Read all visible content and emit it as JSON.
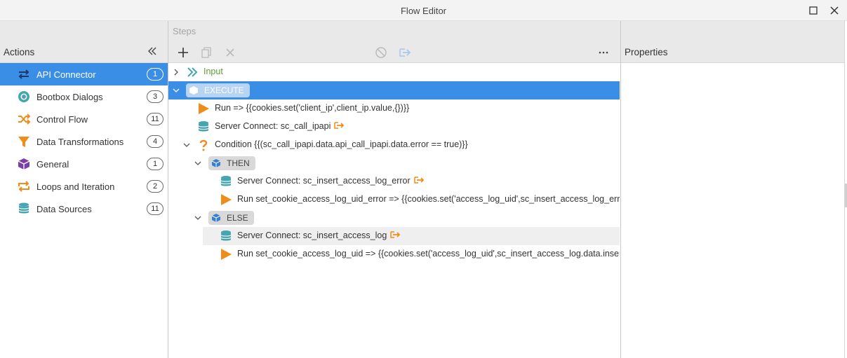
{
  "window": {
    "title": "Flow Editor"
  },
  "actions_panel": {
    "header": "Actions",
    "items": [
      {
        "label": "API Connector",
        "count": "1",
        "icon": "api-connector-icon",
        "selected": true
      },
      {
        "label": "Bootbox Dialogs",
        "count": "3",
        "icon": "chrome-icon"
      },
      {
        "label": "Control Flow",
        "count": "11",
        "icon": "shuffle-icon"
      },
      {
        "label": "Data Transformations",
        "count": "4",
        "icon": "funnel-icon"
      },
      {
        "label": "General",
        "count": "1",
        "icon": "cube-icon"
      },
      {
        "label": "Loops and Iteration",
        "count": "2",
        "icon": "loop-icon"
      },
      {
        "label": "Data Sources",
        "count": "11",
        "icon": "database-icon"
      }
    ]
  },
  "steps_panel": {
    "header": "Steps",
    "toolbar": [
      "add-icon",
      "copy-icon",
      "delete-icon",
      "disable-icon",
      "export-icon",
      "more-icon"
    ],
    "tree": {
      "input": "Input",
      "execute": "EXECUTE",
      "run1": "Run => {{cookies.set('client_ip',client_ip.value,{})}}",
      "server_connect1": "Server Connect: sc_call_ipapi",
      "condition": "Condition {{(sc_call_ipapi.data.api_call_ipapi.data.error == true)}}",
      "then": "THEN",
      "then_server_connect": "Server Connect: sc_insert_access_log_error",
      "then_run": "Run set_cookie_access_log_uid_error => {{cookies.set('access_log_uid',sc_insert_access_log_error",
      "else": "ELSE",
      "else_server_connect": "Server Connect: sc_insert_access_log",
      "else_run": "Run set_cookie_access_log_uid => {{cookies.set('access_log_uid',sc_insert_access_log.data.insert_"
    }
  },
  "properties_panel": {
    "header": "Properties"
  },
  "colors": {
    "accent": "#3a8ee6",
    "orange": "#f08c1a",
    "teal": "#45a5b0",
    "purple": "#7b3fa8",
    "green": "#5ea13a"
  }
}
